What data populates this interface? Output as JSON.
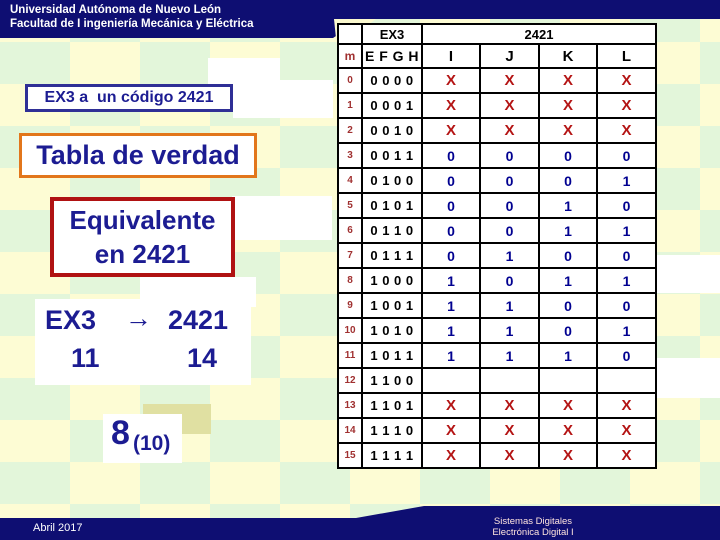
{
  "colors": {
    "navy": "#0e0e72",
    "text-navy": "#1c1c92",
    "border-navy": "#2f2f96",
    "orange": "#e2761b",
    "darkred": "#b01212",
    "gray": "#c0c0c0",
    "yellow": "#ffffbb",
    "x-red": "#b41414",
    "bit-navy": "#000090",
    "m-red": "#a03030",
    "khaki": "#e0e0a2",
    "footer-pink": "#ffe4de"
  },
  "header": {
    "line1": "Universidad Autónoma de Nuevo León",
    "line2": "Facultad de I ingeniería Mecánica y Eléctrica"
  },
  "left_panel": {
    "title_box": "EX3 a  un código 2421",
    "truth_table_box": "Tabla de verdad",
    "equivalent_box": {
      "line1": "Equivalente",
      "line2": "en 2421"
    },
    "mapping": {
      "source": "EX3",
      "arrow": "→",
      "target": "2421",
      "source_count": "11",
      "target_count": "14"
    },
    "base_note": {
      "digit": "8",
      "subscript": "(10)"
    }
  },
  "table": {
    "group_header": {
      "ex3": "EX3",
      "code": "2421"
    },
    "columns": {
      "m": "m",
      "efgh": "E F G H",
      "outputs": [
        "I",
        "J",
        "K",
        "L"
      ]
    },
    "rows": [
      {
        "m": "0",
        "efgh": "0 0 0 0",
        "outputs": [
          "X",
          "X",
          "X",
          "X"
        ]
      },
      {
        "m": "1",
        "efgh": "0 0 0 1",
        "outputs": [
          "X",
          "X",
          "X",
          "X"
        ]
      },
      {
        "m": "2",
        "efgh": "0 0 1 0",
        "outputs": [
          "X",
          "X",
          "X",
          "X"
        ]
      },
      {
        "m": "3",
        "efgh": "0 0 1 1",
        "outputs": [
          "0",
          "0",
          "0",
          "0"
        ]
      },
      {
        "m": "4",
        "efgh": "0 1 0 0",
        "outputs": [
          "0",
          "0",
          "0",
          "1"
        ]
      },
      {
        "m": "5",
        "efgh": "0 1 0 1",
        "outputs": [
          "0",
          "0",
          "1",
          "0"
        ]
      },
      {
        "m": "6",
        "efgh": "0 1 1 0",
        "outputs": [
          "0",
          "0",
          "1",
          "1"
        ]
      },
      {
        "m": "7",
        "efgh": "0 1 1 1",
        "outputs": [
          "0",
          "1",
          "0",
          "0"
        ]
      },
      {
        "m": "8",
        "efgh": "1 0 0 0",
        "outputs": [
          "1",
          "0",
          "1",
          "1"
        ]
      },
      {
        "m": "9",
        "efgh": "1 0 0 1",
        "outputs": [
          "1",
          "1",
          "0",
          "0"
        ]
      },
      {
        "m": "10",
        "efgh": "1 0 1 0",
        "outputs": [
          "1",
          "1",
          "0",
          "1"
        ]
      },
      {
        "m": "11",
        "efgh": "1 0 1 1",
        "outputs": [
          "1",
          "1",
          "1",
          "0"
        ]
      },
      {
        "m": "12",
        "efgh": "1 1 0 0",
        "outputs": [
          "",
          "",
          "",
          ""
        ]
      },
      {
        "m": "13",
        "efgh": "1 1 0 1",
        "outputs": [
          "X",
          "X",
          "X",
          "X"
        ]
      },
      {
        "m": "14",
        "efgh": "1 1 1 0",
        "outputs": [
          "X",
          "X",
          "X",
          "X"
        ]
      },
      {
        "m": "15",
        "efgh": "1 1 1 1",
        "outputs": [
          "X",
          "X",
          "X",
          "X"
        ]
      }
    ]
  },
  "footer": {
    "date": "Abril 2017",
    "course_line1": "Sistemas Digitales",
    "course_line2": "Electrónica Digital I"
  }
}
